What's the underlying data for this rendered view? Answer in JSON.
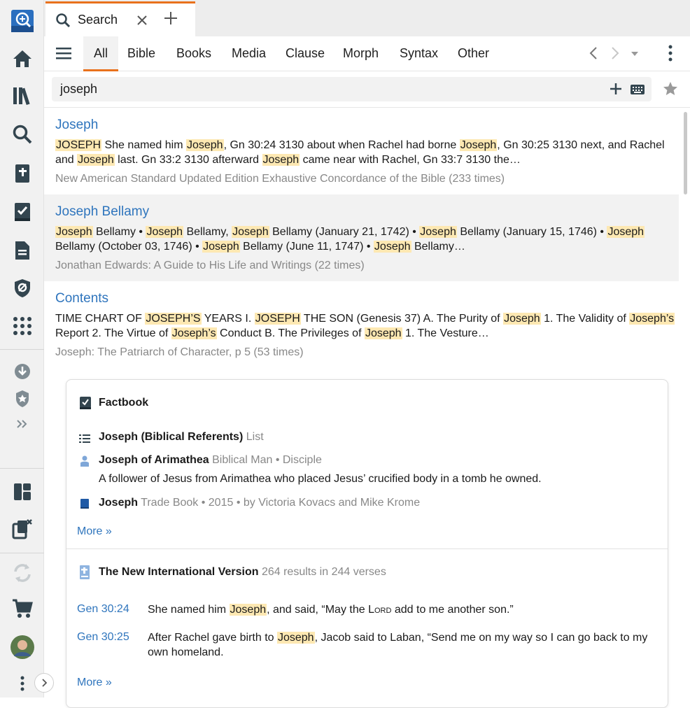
{
  "tab": {
    "title": "Search",
    "close_icon": "close-icon",
    "add_icon": "plus-icon"
  },
  "filters": [
    "All",
    "Bible",
    "Books",
    "Media",
    "Clause",
    "Morph",
    "Syntax",
    "Other"
  ],
  "active_filter": "All",
  "search": {
    "value": "joseph"
  },
  "accent_color": "#e8711c",
  "link_color": "#2f75bd",
  "highlight_color": "#fde8b2",
  "results": [
    {
      "title": "Joseph",
      "line1": [
        [
          "JOSEPH",
          true
        ],
        [
          " She named him ",
          false
        ],
        [
          "Joseph",
          true
        ],
        [
          ", Gn 30:24 3130 about when Rachel had borne ",
          false
        ],
        [
          "Joseph",
          true
        ],
        [
          ", Gn 30:25 3130 next, and Rachel",
          false
        ]
      ],
      "line2": [
        [
          "and ",
          false
        ],
        [
          "Joseph",
          true
        ],
        [
          " last. Gn 33:2 3130 afterward ",
          false
        ],
        [
          "Joseph",
          true
        ],
        [
          " came near with Rachel, Gn 33:7 3130 the…",
          false
        ]
      ],
      "source": "New American Standard Updated Edition Exhaustive Concordance of the Bible (233 times)"
    },
    {
      "title": "Joseph Bellamy",
      "line1": [
        [
          "Joseph",
          true
        ],
        [
          " Bellamy • ",
          false
        ],
        [
          "Joseph",
          true
        ],
        [
          " Bellamy, ",
          false
        ],
        [
          "Joseph",
          true
        ],
        [
          " Bellamy (January 21, 1742) • ",
          false
        ],
        [
          "Joseph",
          true
        ],
        [
          " Bellamy (January 15, 1746) • ",
          false
        ],
        [
          "Joseph",
          true
        ]
      ],
      "line2": [
        [
          "Bellamy (October 03, 1746) • ",
          false
        ],
        [
          "Joseph",
          true
        ],
        [
          " Bellamy (June 11, 1747) • ",
          false
        ],
        [
          "Joseph",
          true
        ],
        [
          " Bellamy…",
          false
        ]
      ],
      "source": "Jonathan Edwards: A Guide to His Life and Writings (22 times)"
    },
    {
      "title": "Contents",
      "line1": [
        [
          "TIME CHART OF ",
          false
        ],
        [
          "JOSEPH’S",
          true
        ],
        [
          " YEARS I. ",
          false
        ],
        [
          "JOSEPH",
          true
        ],
        [
          " THE SON (Genesis 37) A. The Purity of ",
          false
        ],
        [
          "Joseph",
          true
        ],
        [
          " 1. The Validity of ",
          false
        ],
        [
          "Joseph’s",
          true
        ]
      ],
      "line2": [
        [
          "Report 2. The Virtue of ",
          false
        ],
        [
          "Joseph’s",
          true
        ],
        [
          " Conduct B. The Privileges of ",
          false
        ],
        [
          "Joseph",
          true
        ],
        [
          " 1. The Vesture…",
          false
        ]
      ],
      "source": "Joseph: The Patriarch of Character, p 5 (53 times)"
    }
  ],
  "factbook": {
    "heading": "Factbook",
    "items": [
      {
        "name": "Joseph (Biblical Referents)",
        "meta": "List",
        "icon": "list-icon"
      },
      {
        "name": "Joseph of Arimathea",
        "meta": "Biblical Man • Disciple",
        "icon": "person-icon",
        "desc": "A follower of Jesus from Arimathea who placed Jesus’ crucified body in a tomb he owned."
      },
      {
        "name": "Joseph",
        "meta": "Trade Book • 2015 • by Victoria Kovacs and Mike Krome",
        "icon": "book-icon"
      }
    ],
    "more": "More »"
  },
  "bible": {
    "heading": "The New International Version",
    "count": "264 results in 244 verses",
    "verses": [
      {
        "ref": "Gen 30:24",
        "parts": [
          [
            "She named him ",
            false
          ],
          [
            "Joseph",
            true
          ],
          [
            ", and said, “May the ",
            false
          ]
        ],
        "lord": "Lord",
        "tail": " add to me another son.”"
      },
      {
        "ref": "Gen 30:25",
        "line1": [
          [
            "After Rachel gave birth to ",
            false
          ],
          [
            "Joseph",
            true
          ],
          [
            ", Jacob said to Laban, “Send me on my way so I can go back to my",
            false
          ]
        ],
        "line2": "own homeland."
      }
    ],
    "more": "More »"
  }
}
